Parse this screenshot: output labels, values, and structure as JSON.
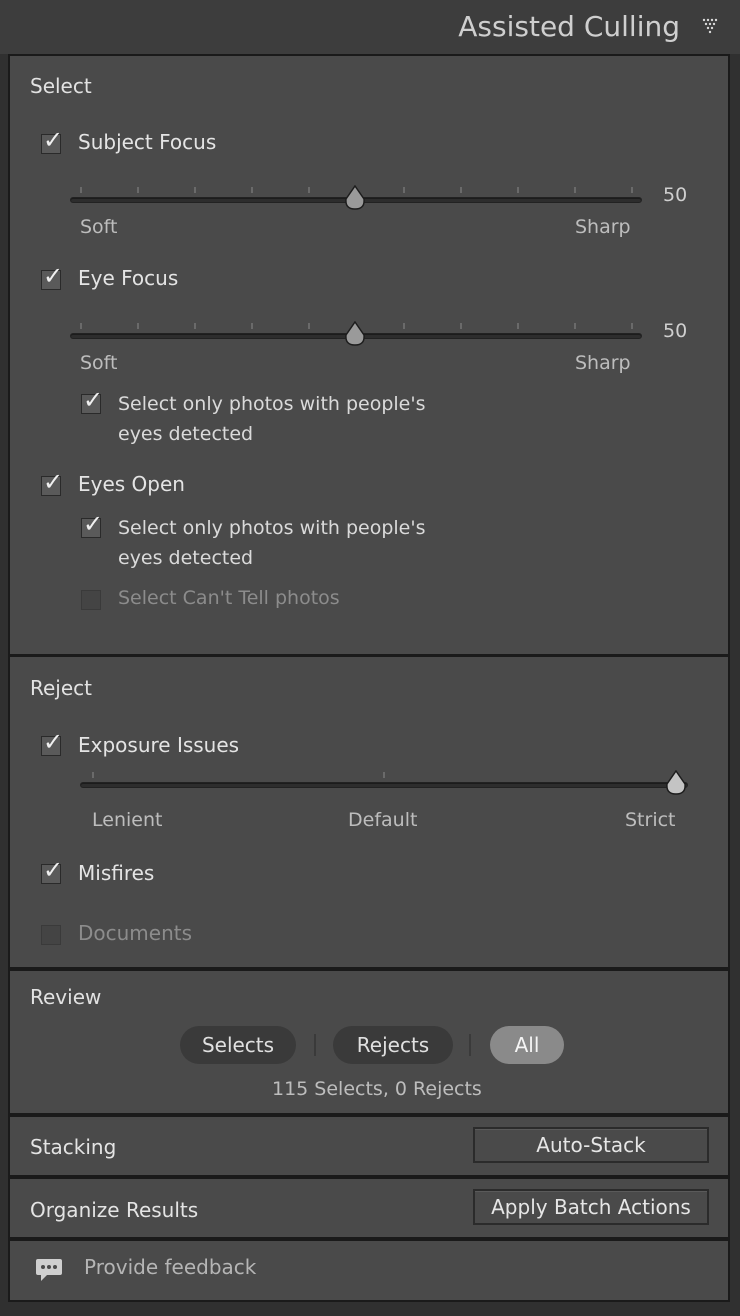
{
  "panel": {
    "title": "Assisted Culling",
    "collapse_icon": "collapse-triangle-icon"
  },
  "select": {
    "title": "Select",
    "subject_focus": {
      "label": "Subject Focus",
      "checked": true,
      "value": "50",
      "min_label": "Soft",
      "max_label": "Sharp"
    },
    "eye_focus": {
      "label": "Eye Focus",
      "checked": true,
      "value": "50",
      "min_label": "Soft",
      "max_label": "Sharp",
      "option": {
        "line1": "Select only photos with people's",
        "line2": "eyes detected",
        "checked": true
      }
    },
    "eyes_open": {
      "label": "Eyes Open",
      "checked": true,
      "option": {
        "line1": "Select only photos with people's",
        "line2": "eyes detected",
        "checked": true
      },
      "cant_tell": {
        "label": "Select Can't Tell photos",
        "checked": false
      }
    }
  },
  "reject": {
    "title": "Reject",
    "exposure": {
      "label": "Exposure Issues",
      "checked": true,
      "level": 1.0,
      "labels": [
        "Lenient",
        "Default",
        "Strict"
      ]
    },
    "misfires": {
      "label": "Misfires",
      "checked": true
    },
    "documents": {
      "label": "Documents",
      "checked": false
    }
  },
  "review": {
    "title": "Review",
    "tabs": [
      {
        "label": "Selects",
        "active": false
      },
      {
        "label": "Rejects",
        "active": false
      },
      {
        "label": "All",
        "active": true
      }
    ],
    "summary": "115 Selects, 0 Rejects"
  },
  "stacking": {
    "label": "Stacking",
    "button": "Auto-Stack"
  },
  "organize": {
    "label": "Organize Results",
    "button": "Apply Batch Actions"
  },
  "feedback": {
    "label": "Provide feedback",
    "icon": "speech-bubble-icon"
  },
  "colors": {
    "panel_bg": "#4a4a4a",
    "active_pill": "#8a8a8a",
    "text": "#e4e4e4"
  }
}
